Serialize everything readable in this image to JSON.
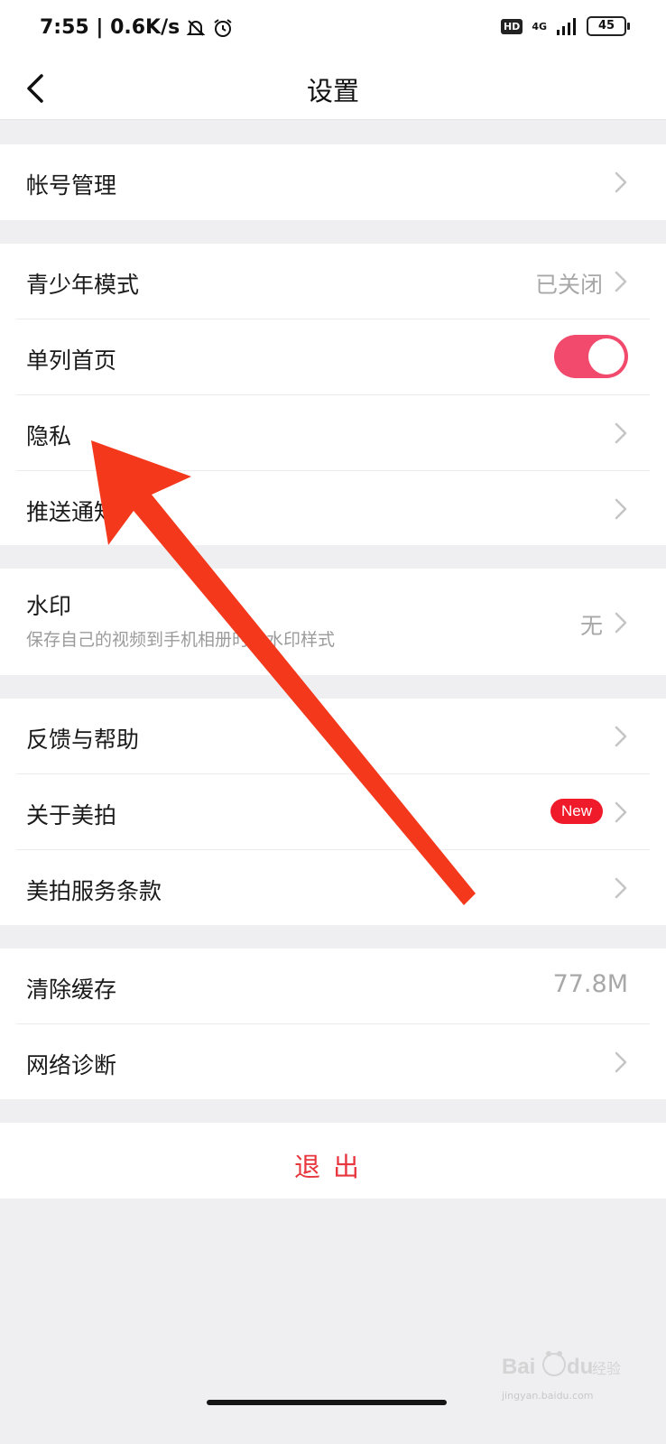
{
  "status_bar": {
    "time_speed": "7:55 | 0.6K/s",
    "hd": "HD",
    "network": "4G",
    "battery": "45"
  },
  "header": {
    "title": "设置"
  },
  "groups": {
    "account": {
      "label": "帐号管理"
    },
    "general": {
      "teen_mode": {
        "label": "青少年模式",
        "value": "已关闭"
      },
      "single_column": {
        "label": "单列首页",
        "enabled": true
      },
      "privacy": {
        "label": "隐私"
      },
      "push": {
        "label": "推送通知"
      }
    },
    "watermark": {
      "label": "水印",
      "subtitle": "保存自己的视频到手机相册时的水印样式",
      "value": "无"
    },
    "about": {
      "feedback": {
        "label": "反馈与帮助"
      },
      "about_meipai": {
        "label": "关于美拍",
        "badge": "New"
      },
      "terms": {
        "label": "美拍服务条款"
      }
    },
    "storage": {
      "clear_cache": {
        "label": "清除缓存",
        "value": "77.8M"
      },
      "network_diag": {
        "label": "网络诊断"
      }
    }
  },
  "logout": {
    "label": "退出"
  },
  "watermark_overlay": {
    "brand": "Bai du 经验",
    "site": "jingyan.baidu.com"
  },
  "colors": {
    "accent_toggle": "#f24a6d",
    "logout_red": "#e8363e",
    "badge_red": "#ef1b2a",
    "annotation_arrow": "#f4381c"
  }
}
